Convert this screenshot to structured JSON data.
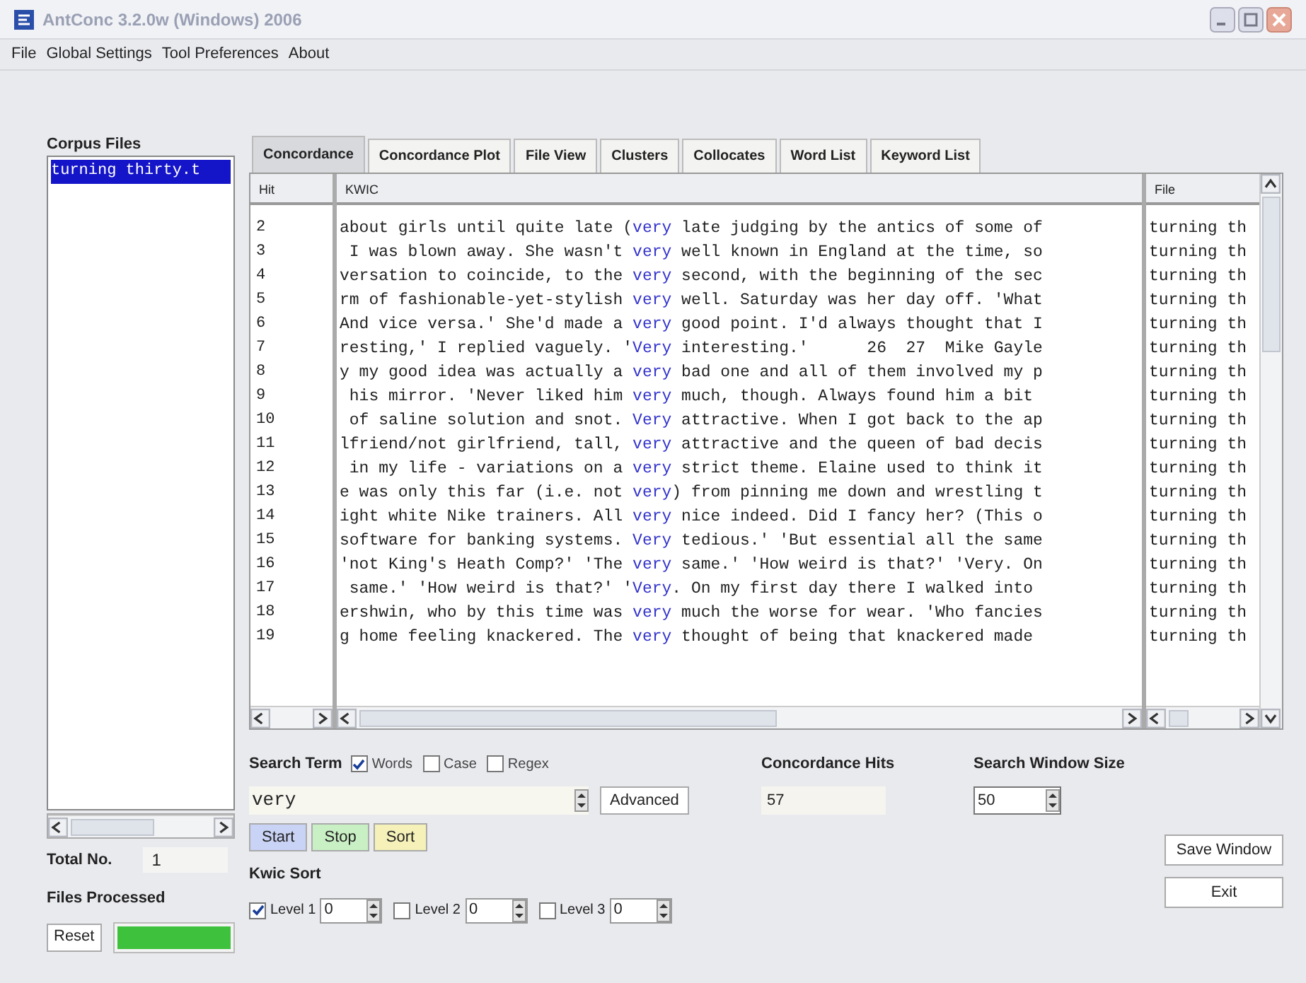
{
  "window": {
    "title": "AntConc 3.2.0w (Windows) 2006"
  },
  "menu": [
    "File",
    "Global Settings",
    "Tool Preferences",
    "About"
  ],
  "corpus_files": {
    "label": "Corpus Files",
    "items": [
      {
        "name": "turning thirty.t",
        "selected": true
      }
    ]
  },
  "total_no": {
    "label": "Total No.",
    "value": "1"
  },
  "files_processed": {
    "label": "Files Processed",
    "level": 1
  },
  "reset_button": "Reset",
  "tabs": [
    {
      "label": "Concordance",
      "selected": true
    },
    {
      "label": "Concordance Plot",
      "selected": false
    },
    {
      "label": "File View",
      "selected": false
    },
    {
      "label": "Clusters",
      "selected": false
    },
    {
      "label": "Collocates",
      "selected": false
    },
    {
      "label": "Word List",
      "selected": false
    },
    {
      "label": "Keyword List",
      "selected": false
    }
  ],
  "table": {
    "columns": [
      "Hit",
      "KWIC",
      "File"
    ],
    "rows": [
      {
        "hit": "2",
        "left": "about girls until quite late (",
        "keyword": "very",
        "right": " late judging by the antics of some of",
        "file": "turning th"
      },
      {
        "hit": "3",
        "left": " I was blown away. She wasn't ",
        "keyword": "very",
        "right": " well known in England at the time, so",
        "file": "turning th"
      },
      {
        "hit": "4",
        "left": "versation to coincide, to the ",
        "keyword": "very",
        "right": " second, with the beginning of the sec",
        "file": "turning th"
      },
      {
        "hit": "5",
        "left": "rm of fashionable-yet-stylish ",
        "keyword": "very",
        "right": " well. Saturday was her day off. 'What",
        "file": "turning th"
      },
      {
        "hit": "6",
        "left": "And vice versa.' She'd made a ",
        "keyword": "very",
        "right": " good point. I'd always thought that I",
        "file": "turning th"
      },
      {
        "hit": "7",
        "left": "resting,' I replied vaguely. '",
        "keyword": "Very",
        "right": " interesting.'      26  27  Mike Gayle",
        "file": "turning th"
      },
      {
        "hit": "8",
        "left": "y my good idea was actually a ",
        "keyword": "very",
        "right": " bad one and all of them involved my p",
        "file": "turning th"
      },
      {
        "hit": "9",
        "left": " his mirror. 'Never liked him ",
        "keyword": "very",
        "right": " much, though. Always found him a bit",
        "file": "turning th"
      },
      {
        "hit": "10",
        "left": " of saline solution and snot. ",
        "keyword": "Very",
        "right": " attractive. When I got back to the ap",
        "file": "turning th"
      },
      {
        "hit": "11",
        "left": "lfriend/not girlfriend, tall, ",
        "keyword": "very",
        "right": " attractive and the queen of bad decis",
        "file": "turning th"
      },
      {
        "hit": "12",
        "left": " in my life - variations on a ",
        "keyword": "very",
        "right": " strict theme. Elaine used to think it",
        "file": "turning th"
      },
      {
        "hit": "13",
        "left": "e was only this far (i.e. not ",
        "keyword": "very",
        "right": ") from pinning me down and wrestling t",
        "file": "turning th"
      },
      {
        "hit": "14",
        "left": "ight white Nike trainers. All ",
        "keyword": "very",
        "right": " nice indeed. Did I fancy her? (This o",
        "file": "turning th"
      },
      {
        "hit": "15",
        "left": "software for banking systems. ",
        "keyword": "Very",
        "right": " tedious.' 'But essential all the same",
        "file": "turning th"
      },
      {
        "hit": "16",
        "left": "'not King's Heath Comp?' 'The ",
        "keyword": "very",
        "right": " same.' 'How weird is that?' 'Very. On",
        "file": "turning th"
      },
      {
        "hit": "17",
        "left": " same.' 'How weird is that?' '",
        "keyword": "Very",
        "right": ". On my first day there I walked into",
        "file": "turning th"
      },
      {
        "hit": "18",
        "left": "ershwin, who by this time was ",
        "keyword": "very",
        "right": " much the worse for wear. 'Who fancies",
        "file": "turning th"
      },
      {
        "hit": "19",
        "left": "g home feeling knackered. The ",
        "keyword": "very",
        "right": " thought of being that knackered made",
        "file": "turning th"
      }
    ]
  },
  "search": {
    "label": "Search Term",
    "options": [
      {
        "label": "Words",
        "checked": true
      },
      {
        "label": "Case",
        "checked": false
      },
      {
        "label": "Regex",
        "checked": false
      }
    ],
    "value": "very",
    "advanced_button": "Advanced",
    "buttons": [
      {
        "label": "Start",
        "color": "#c9d3f5"
      },
      {
        "label": "Stop",
        "color": "#c9f0c4"
      },
      {
        "label": "Sort",
        "color": "#f5f1b8"
      }
    ]
  },
  "concordance_hits": {
    "label": "Concordance Hits",
    "value": "57"
  },
  "search_window_size": {
    "label": "Search Window Size",
    "value": "50"
  },
  "kwic_sort": {
    "label": "Kwic Sort",
    "levels": [
      {
        "label": "Level 1",
        "checked": true,
        "value": "0"
      },
      {
        "label": "Level 2",
        "checked": false,
        "value": "0"
      },
      {
        "label": "Level 3",
        "checked": false,
        "value": "0"
      }
    ]
  },
  "save_window_button": "Save Window",
  "exit_button": "Exit"
}
